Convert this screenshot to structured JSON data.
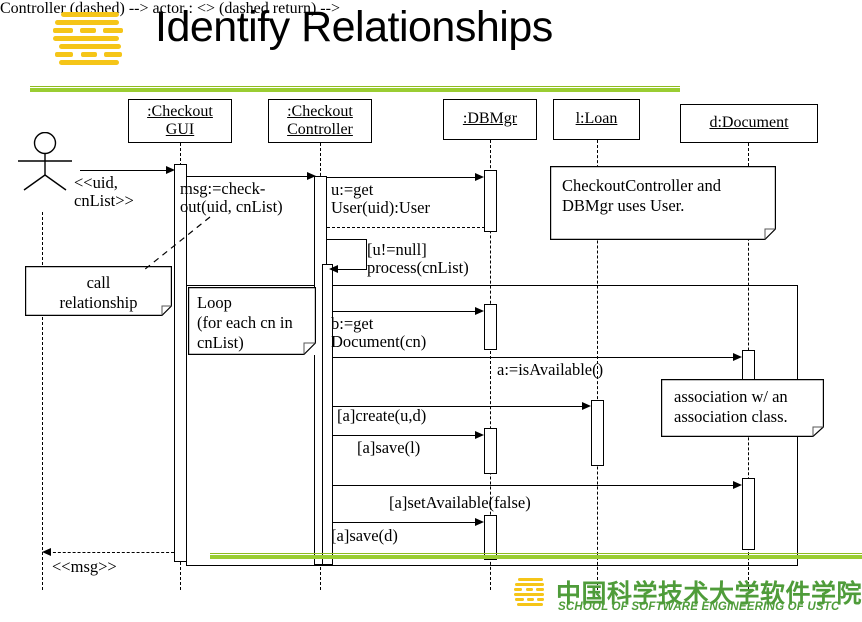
{
  "slide": {
    "title": "Identify Relationships",
    "logo_icon": "ustc-sse-s-logo",
    "accent_green": "#9acd32",
    "footer": {
      "logo_icon": "ustc-sse-s-logo",
      "chinese": "中国科学技术大学软件学院",
      "english": "SCHOOL OF SOFTWARE ENGINEERING OF USTC",
      "color": "#4f9c3a"
    }
  },
  "diagram": {
    "type": "uml-sequence-diagram",
    "actor": {
      "name": "actor-stick-figure",
      "label": ""
    },
    "lifelines": [
      {
        "id": "gui",
        "label_line1": ":Checkout",
        "label_line2": "GUI"
      },
      {
        "id": "controller",
        "label_line1": ":Checkout",
        "label_line2": "Controller"
      },
      {
        "id": "dbmgr",
        "label_line1": ":DBMgr",
        "label_line2": ""
      },
      {
        "id": "loan",
        "label_line1": "l:Loan",
        "label_line2": ""
      },
      {
        "id": "document",
        "label_line1": "d:Document",
        "label_line2": ""
      }
    ],
    "messages": [
      {
        "id": "m1",
        "text": "<<uid,\ncnList>>"
      },
      {
        "id": "m2",
        "text": "msg:=check-\nout(uid, cnList)"
      },
      {
        "id": "m3",
        "text": "u:=get\nUser(uid):User"
      },
      {
        "id": "m4",
        "text": "[u!=null]\nprocess(cnList)"
      },
      {
        "id": "m5",
        "text": "b:=get\nDocument(cn)"
      },
      {
        "id": "m6",
        "text": "a:=isAvailable()"
      },
      {
        "id": "m7",
        "text": "[a]create(u,d)"
      },
      {
        "id": "m8",
        "text": "[a]save(l)"
      },
      {
        "id": "m9",
        "text": "[a]setAvailable(false)"
      },
      {
        "id": "m10",
        "text": "[a]save(d)"
      },
      {
        "id": "m11",
        "text": "<<msg>>"
      }
    ],
    "notes": [
      {
        "id": "n1",
        "text": "call\nrelationship"
      },
      {
        "id": "n2",
        "text": "CheckoutController and\nDBMgr uses User."
      },
      {
        "id": "n3",
        "text": "Loop\n(for each cn in\ncnList)"
      },
      {
        "id": "n4",
        "text": "association w/ an\nassociation class."
      }
    ]
  }
}
